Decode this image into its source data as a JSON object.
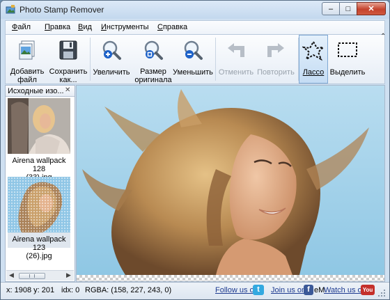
{
  "window": {
    "title": "Photo Stamp Remover"
  },
  "menu": [
    "Файл",
    "Правка",
    "Вид",
    "Инструменты",
    "Справка"
  ],
  "toolbar": {
    "add": [
      "Добавить",
      "файл"
    ],
    "save": [
      "Сохранить",
      "как..."
    ],
    "zoom_in": "Увеличить",
    "original": [
      "Размер",
      "оригинала"
    ],
    "zoom_out": "Уменьшить",
    "undo": "Отменить",
    "redo": "Повторить",
    "lasso": "Лассо",
    "select": "Выделить"
  },
  "sidebar": {
    "title": "Исходные изо...",
    "files": [
      {
        "caption": [
          "Airena wallpack 128",
          "(33).jpg"
        ]
      },
      {
        "caption": [
          "Airena wallpack 123",
          "(26).jpg"
        ]
      }
    ]
  },
  "status": {
    "coords": "x: 1908 y: 201",
    "idx": "idx: 0",
    "rgba": "RGBA: (158, 227, 243, 0)",
    "follow": "Follow us on",
    "join": "Join us on",
    "watch": "Watch us on",
    "twitter_icon": "t",
    "facebook_icon": "f",
    "youtube_icon": "You",
    "em": "eM"
  },
  "colors": {
    "accent": "#3c76bf",
    "close": "#c4432d",
    "sky": "#9ed0ea"
  }
}
